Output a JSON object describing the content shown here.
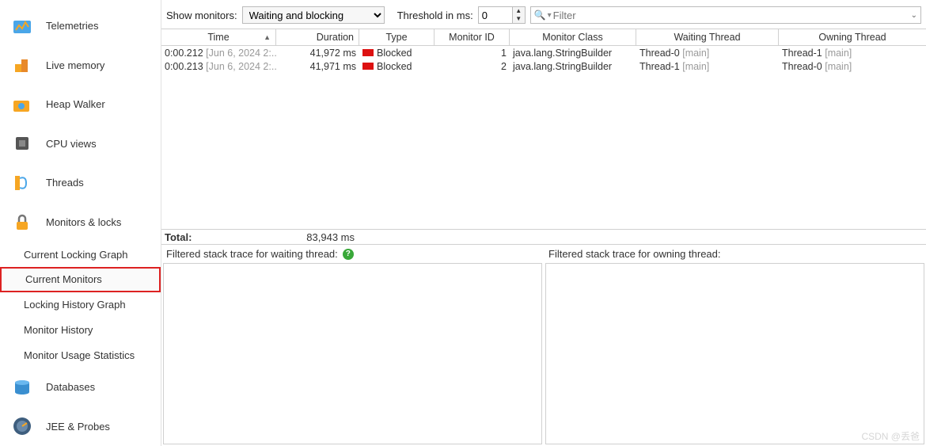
{
  "sidebar": {
    "items": [
      {
        "label": "Telemetries"
      },
      {
        "label": "Live memory"
      },
      {
        "label": "Heap Walker"
      },
      {
        "label": "CPU views"
      },
      {
        "label": "Threads"
      },
      {
        "label": "Monitors & locks"
      }
    ],
    "subitems": [
      {
        "label": "Current Locking Graph"
      },
      {
        "label": "Current Monitors"
      },
      {
        "label": "Locking History Graph"
      },
      {
        "label": "Monitor History"
      },
      {
        "label": "Monitor Usage Statistics"
      }
    ],
    "footer": [
      {
        "label": "Databases"
      },
      {
        "label": "JEE & Probes"
      }
    ]
  },
  "toolbar": {
    "show_monitors_label": "Show monitors:",
    "show_monitors_value": "Waiting and blocking",
    "threshold_label": "Threshold in ms:",
    "threshold_value": "0",
    "filter_placeholder": "Filter"
  },
  "table": {
    "headers": {
      "time": "Time",
      "duration": "Duration",
      "type": "Type",
      "mid": "Monitor ID",
      "mclass": "Monitor Class",
      "wt": "Waiting Thread",
      "ot": "Owning Thread"
    },
    "sort_indicator": "▲",
    "rows": [
      {
        "time": "0:00.212",
        "time_date": "[Jun 6, 2024 2:...",
        "duration": "41,972 ms",
        "type": "Blocked",
        "mid": "1",
        "mclass": "java.lang.StringBuilder",
        "wt": "Thread-0",
        "wt_group": "[main]",
        "ot": "Thread-1",
        "ot_group": "[main]"
      },
      {
        "time": "0:00.213",
        "time_date": "[Jun 6, 2024 2:...",
        "duration": "41,971 ms",
        "type": "Blocked",
        "mid": "2",
        "mclass": "java.lang.StringBuilder",
        "wt": "Thread-1",
        "wt_group": "[main]",
        "ot": "Thread-0",
        "ot_group": "[main]"
      }
    ],
    "total_label": "Total:",
    "total_duration": "83,943 ms"
  },
  "stack": {
    "waiting_label": "Filtered stack trace for waiting thread:",
    "owning_label": "Filtered stack trace for owning thread:"
  },
  "watermark": "CSDN @丢爸"
}
